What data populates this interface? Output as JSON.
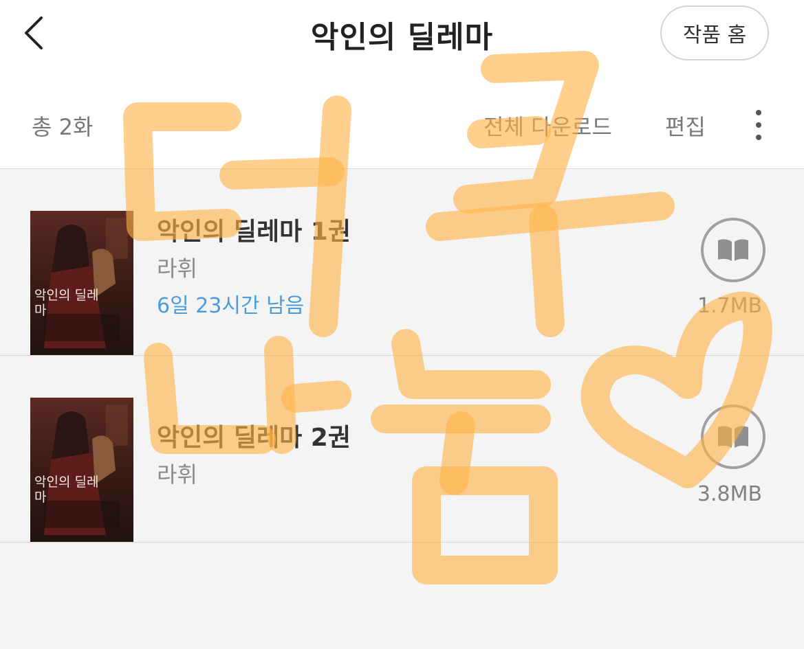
{
  "header": {
    "title": "악인의 딜레마",
    "home_button": "작품 홈"
  },
  "toolbar": {
    "count": "총 2화",
    "download_all": "전체 다운로드",
    "edit": "편집"
  },
  "items": [
    {
      "title": "악인의 딜레마 1권",
      "author": "라휘",
      "remaining": "6일 23시간 남음",
      "size": "1.7MB",
      "cover_title": "악인의 딜레마"
    },
    {
      "title": "악인의 딜레마 2권",
      "author": "라휘",
      "size": "3.8MB",
      "cover_title": "악인의 딜레마"
    }
  ],
  "overlay": {
    "handwriting": "더쿠 나눔♡",
    "color": "#ffb347"
  },
  "colors": {
    "accent": "#4a9cdf",
    "background": "#f4f4f4"
  },
  "icons": [
    "chevron-left-icon",
    "more-vertical-icon",
    "open-book-icon"
  ]
}
